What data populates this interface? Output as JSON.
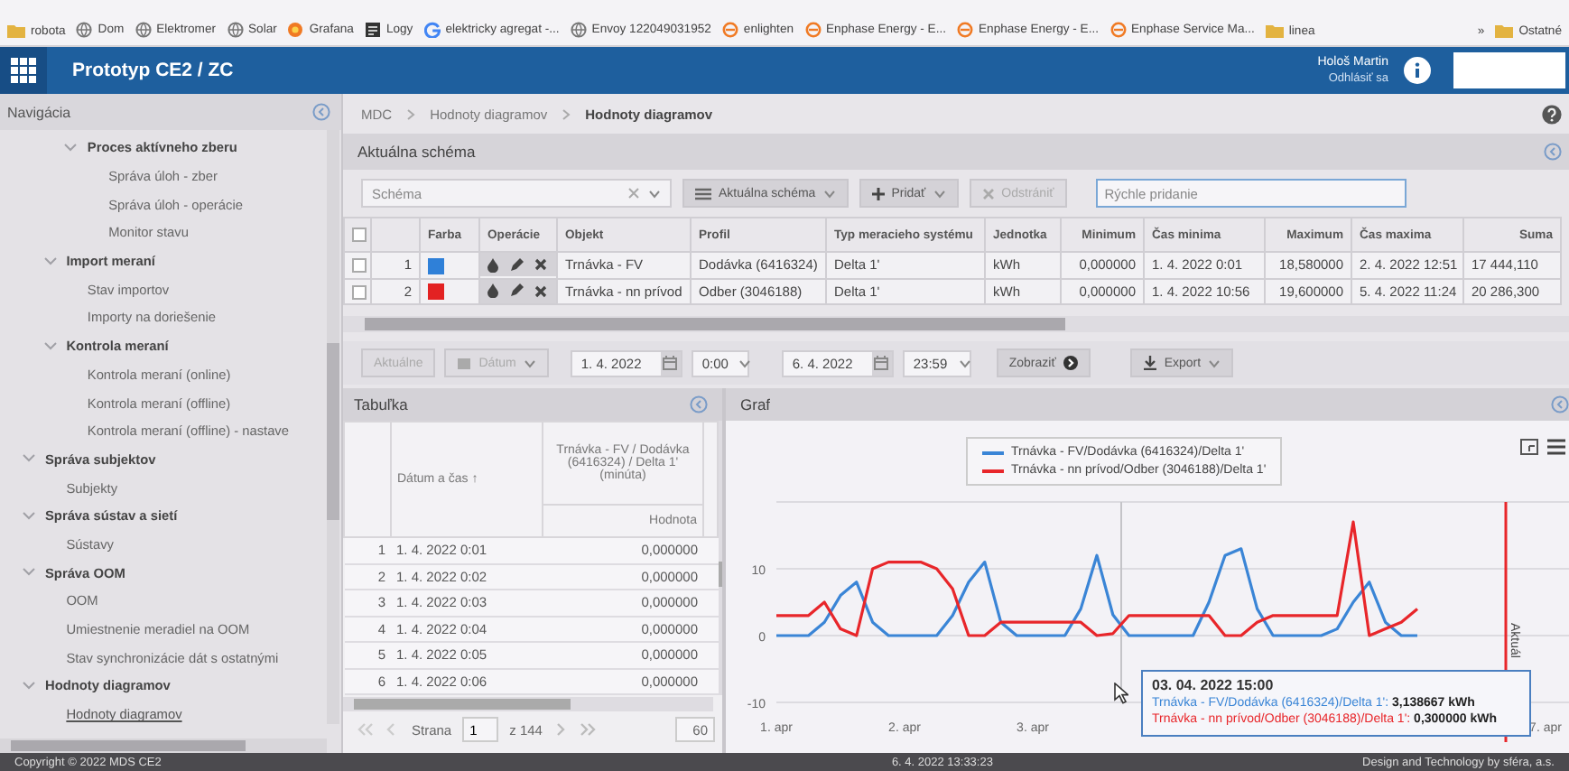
{
  "bookmarks": {
    "items": [
      {
        "label": "robota",
        "kind": "folder"
      },
      {
        "label": "Dom",
        "kind": "globe"
      },
      {
        "label": "Elektromer",
        "kind": "globe"
      },
      {
        "label": "Solar",
        "kind": "globe"
      },
      {
        "label": "Grafana",
        "kind": "grafana"
      },
      {
        "label": "Logy",
        "kind": "logy"
      },
      {
        "label": "elektricky agregat -...",
        "kind": "google"
      },
      {
        "label": "Envoy 122049031952",
        "kind": "globe"
      },
      {
        "label": "enlighten",
        "kind": "enphase"
      },
      {
        "label": "Enphase Energy - E...",
        "kind": "enphase"
      },
      {
        "label": "Enphase Energy - E...",
        "kind": "enphase"
      },
      {
        "label": "Enphase Service Ma...",
        "kind": "enphase"
      },
      {
        "label": "linea",
        "kind": "folder"
      }
    ],
    "overflow": "»",
    "other": {
      "label": "Ostatné",
      "kind": "folder"
    }
  },
  "header": {
    "title": "Prototyp CE2 / ZC",
    "user": "Hološ Martin",
    "logout": "Odhlásiť sa"
  },
  "navigation": {
    "title": "Navigácia",
    "items": [
      {
        "children": [
          {
            "children": [
              {
                "label": "Proces aktívneho zberu",
                "expanded": true,
                "selected": false,
                "children": [
                  {
                    "label": "Správa úloh - zber",
                    "selected": false
                  },
                  {
                    "label": "Správa úloh - operácie",
                    "selected": false
                  },
                  {
                    "label": "Monitor stavu",
                    "selected": false
                  }
                ]
              }
            ]
          },
          {
            "label": "Import meraní",
            "expanded": true,
            "selected": false,
            "children": [
              {
                "label": "Stav importov",
                "selected": false
              },
              {
                "label": "Importy na doriešenie",
                "selected": false
              }
            ]
          },
          {
            "label": "Kontrola meraní",
            "expanded": true,
            "selected": false,
            "children": [
              {
                "label": "Kontrola meraní (online)",
                "selected": false
              },
              {
                "label": "Kontrola meraní (offline)",
                "selected": false
              },
              {
                "label": "Kontrola meraní (offline) - nastave",
                "selected": false
              }
            ]
          }
        ]
      },
      {
        "label": "Správa subjektov",
        "expanded": true,
        "selected": false,
        "children": [
          {
            "label": "Subjekty",
            "selected": false
          }
        ]
      },
      {
        "label": "Správa sústav a sietí",
        "expanded": true,
        "selected": false,
        "children": [
          {
            "label": "Sústavy",
            "selected": false
          }
        ]
      },
      {
        "label": "Správa OOM",
        "expanded": true,
        "selected": false,
        "children": [
          {
            "label": "OOM",
            "selected": false
          },
          {
            "label": "Umiestnenie meradiel na OOM",
            "selected": false
          },
          {
            "label": "Stav synchronizácie dát s ostatnými",
            "selected": false
          }
        ]
      },
      {
        "label": "Hodnoty diagramov",
        "expanded": true,
        "selected": false,
        "children": [
          {
            "label": "Hodnoty diagramov",
            "selected": true
          }
        ]
      }
    ]
  },
  "breadcrumb": [
    "MDC",
    "Hodnoty diagramov",
    "Hodnoty diagramov"
  ],
  "schema_panel": {
    "title": "Aktuálna schéma",
    "schema_select": {
      "placeholder": "Schéma"
    },
    "buttons": [
      {
        "label": "Aktuálna schéma",
        "kind": "list",
        "disabled": false
      },
      {
        "label": "Pridať",
        "kind": "add",
        "disabled": false
      },
      {
        "label": "Odstrániť",
        "kind": "remove",
        "disabled": true
      }
    ],
    "quick_add": {
      "placeholder": "Rýchle pridanie"
    },
    "table": {
      "select_all": false,
      "columns": [
        "Farba",
        "Operácie",
        "Objekt",
        "Profil",
        "Typ meracieho systému",
        "Jednotka",
        "Minimum",
        "Čas minima",
        "Maximum",
        "Čas maxima",
        "Suma"
      ],
      "rows": [
        {
          "checked": false,
          "number": "1",
          "color": "#2f80d8",
          "object": "Trnávka - FV",
          "profile": "Dodávka (6416324)",
          "meter_type": "Delta 1'",
          "unit": "kWh",
          "minimum": "0,000000",
          "min_time": "1. 4. 2022 0:01",
          "maximum": "18,580000",
          "max_time": "2. 4. 2022 12:51",
          "sum": "17 444,110"
        },
        {
          "checked": false,
          "number": "2",
          "color": "#e32222",
          "object": "Trnávka - nn prívod",
          "profile": "Odber (3046188)",
          "meter_type": "Delta 1'",
          "unit": "kWh",
          "minimum": "0,000000",
          "min_time": "1. 4. 2022 10:56",
          "maximum": "19,600000",
          "max_time": "5. 4. 2022 11:24",
          "sum": "20 286,300"
        }
      ]
    }
  },
  "date_toolbar": {
    "current": "Aktuálne",
    "range_type": "Dátum",
    "from_date": "1. 4. 2022",
    "from_time": "0:00",
    "to_date": "6. 4. 2022",
    "to_time": "23:59",
    "show": "Zobraziť",
    "export": "Export"
  },
  "table_panel": {
    "title": "Tabuľka",
    "datetime_column": "Dátum a čas",
    "sort_arrow": "↑",
    "series_column": "Trnávka - FV / Dodávka (6416324) / Delta 1' (minúta)",
    "value_column": "Hodnota",
    "rows": [
      {
        "number": "1",
        "datetime": "1. 4. 2022 0:01",
        "value": "0,000000"
      },
      {
        "number": "2",
        "datetime": "1. 4. 2022 0:02",
        "value": "0,000000"
      },
      {
        "number": "3",
        "datetime": "1. 4. 2022 0:03",
        "value": "0,000000"
      },
      {
        "number": "4",
        "datetime": "1. 4. 2022 0:04",
        "value": "0,000000"
      },
      {
        "number": "5",
        "datetime": "1. 4. 2022 0:05",
        "value": "0,000000"
      },
      {
        "number": "6",
        "datetime": "1. 4. 2022 0:06",
        "value": "0,000000"
      }
    ],
    "pager": {
      "page_label": "Strana",
      "page": "1",
      "of": "z 144",
      "page_size": "60"
    }
  },
  "graph": {
    "title": "Graf",
    "chart_data": {
      "type": "line",
      "categories": [
        "1. apr",
        null,
        null,
        null,
        null,
        null,
        null,
        null,
        "2. apr",
        null,
        null,
        null,
        null,
        null,
        null,
        null,
        "3. apr",
        null,
        null,
        null,
        null,
        null,
        null,
        null,
        null,
        null,
        null,
        null,
        null,
        null,
        null,
        null,
        null,
        null,
        null,
        null,
        null,
        null,
        null,
        null,
        null,
        null,
        null,
        null,
        null,
        null,
        null,
        null,
        "7. apr"
      ],
      "series": [
        {
          "name": "Trnávka - FV/Dodávka (6416324)/Delta 1'",
          "color": "#3a85d6",
          "values": [
            0,
            0,
            0,
            2,
            6,
            8,
            2,
            0,
            0,
            0,
            0,
            3,
            8,
            11,
            2,
            0,
            0,
            0,
            0,
            4,
            12,
            3.1,
            0,
            0,
            0,
            0,
            0,
            5,
            12,
            13,
            4,
            0,
            0,
            0,
            0,
            1,
            5,
            8,
            2,
            0,
            0,
            null,
            null,
            null,
            null,
            null,
            null,
            null,
            null
          ]
        },
        {
          "name": "Trnávka - nn prívod/Odber (3046188)/Delta 1'",
          "color": "#e8262a",
          "values": [
            3,
            3,
            3,
            5,
            1,
            0,
            10,
            11,
            11,
            11,
            10,
            7,
            0,
            0,
            2,
            2,
            2,
            2,
            2,
            2,
            0,
            0.3,
            3,
            3,
            3,
            3,
            3,
            3,
            0,
            0,
            2,
            3,
            3,
            3,
            3,
            3,
            17,
            0,
            1,
            2,
            4,
            null,
            null,
            null,
            null,
            null,
            null,
            null,
            null
          ]
        }
      ],
      "legend": "top",
      "ylim": [
        -10,
        20
      ],
      "yticks": [
        -10,
        0,
        10
      ]
    },
    "current_marker": {
      "label": "Aktuál"
    },
    "tooltip": {
      "title": "03. 04. 2022 15:00",
      "lines": [
        "Trnávka - FV/Dodávka (6416324)/Delta 1': **3,138667 kWh**",
        "Trnávka - nn prívod/Odber (3046188)/Delta 1': **0,300000 kWh**"
      ]
    }
  },
  "footer": {
    "copyright": "Copyright © 2022 MDS CE2",
    "timestamp": "6. 4. 2022 13:33:23",
    "credit": "Design and Technology by sféra, a.s."
  }
}
